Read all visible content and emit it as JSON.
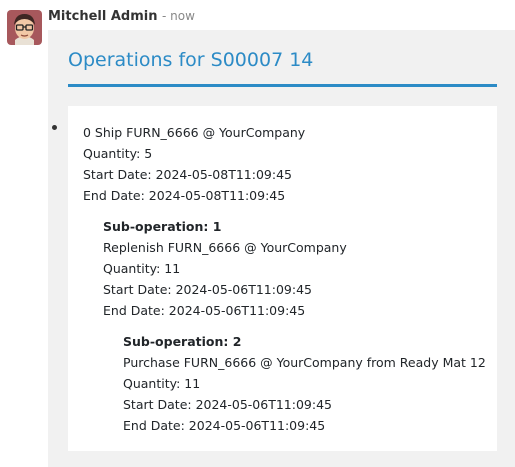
{
  "message": {
    "author": "Mitchell Admin",
    "time": "- now",
    "avatar_icon": "avatar-face-icon"
  },
  "title": "Operations for S00007 14",
  "operation": {
    "name": "0 Ship FURN_6666 @ YourCompany",
    "quantity": "Quantity: 5",
    "start": "Start Date: 2024-05-08T11:09:45",
    "end": "End Date: 2024-05-08T11:09:45",
    "sub": {
      "heading": "Sub-operation: 1",
      "name": "Replenish FURN_6666 @ YourCompany",
      "quantity": "Quantity: 11",
      "start": "Start Date: 2024-05-06T11:09:45",
      "end": "End Date: 2024-05-06T11:09:45",
      "sub": {
        "heading": "Sub-operation: 2",
        "name": "Purchase FURN_6666 @ YourCompany from Ready Mat 12",
        "quantity": "Quantity: 11",
        "start": "Start Date: 2024-05-06T11:09:45",
        "end": "End Date: 2024-05-06T11:09:45"
      }
    }
  }
}
